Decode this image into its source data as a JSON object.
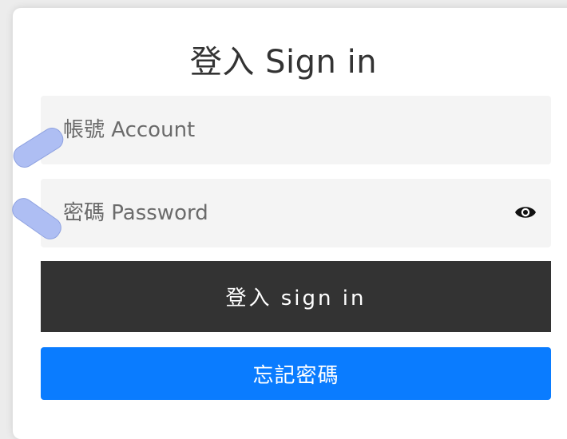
{
  "login": {
    "title": "登入 Sign in",
    "account_placeholder": "帳號 Account",
    "password_placeholder": "密碼 Password",
    "signin_label": "登入 sign in",
    "forgot_label": "忘記密碼"
  },
  "icons": {
    "password_toggle": "eye-icon"
  },
  "colors": {
    "signin_button": "#333333",
    "forgot_button": "#0a7cff",
    "field_background": "#f4f4f4",
    "annotation_mark": "#aebef3"
  }
}
